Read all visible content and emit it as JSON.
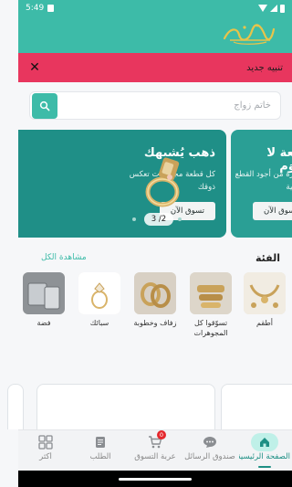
{
  "status_bar": {
    "time": "5:49"
  },
  "notice": {
    "label": "تنبيه جديد"
  },
  "search": {
    "placeholder": "خاتم زواج"
  },
  "banners": [
    {
      "title": "ذهب يُشبهك",
      "desc": "كل قطعة مجوهرات تعكس ذوقك",
      "button": "تسوق الآن"
    },
    {
      "title": "قطعة لا تُقاوَم",
      "desc": "مختارة من أجود القطع الذهبية",
      "button": "تسوق الآن"
    }
  ],
  "pager": {
    "label": "3 /2"
  },
  "categories_section": {
    "heading": "الفئة",
    "view_all": "مشاهدة الكل",
    "items": [
      {
        "name": "أطقم"
      },
      {
        "name": "تسوّقوا كل المجوهرات"
      },
      {
        "name": "زفاف وخطوبة"
      },
      {
        "name": "سبائك"
      },
      {
        "name": "فضة"
      }
    ]
  },
  "bottom_nav": {
    "items": [
      {
        "label": "الصفحة الرئيسية",
        "icon": "home-icon",
        "active": true
      },
      {
        "label": "صندوق الرسائل",
        "icon": "chat-icon"
      },
      {
        "label": "عربة التسوق",
        "icon": "cart-icon",
        "badge": "0"
      },
      {
        "label": "الطلب",
        "icon": "orders-icon"
      },
      {
        "label": "أكثر",
        "icon": "more-icon"
      }
    ]
  },
  "colors": {
    "primary": "#3dbba8",
    "notice": "#e8365e",
    "banner": "#1f8f87",
    "badge": "#e5282d"
  }
}
